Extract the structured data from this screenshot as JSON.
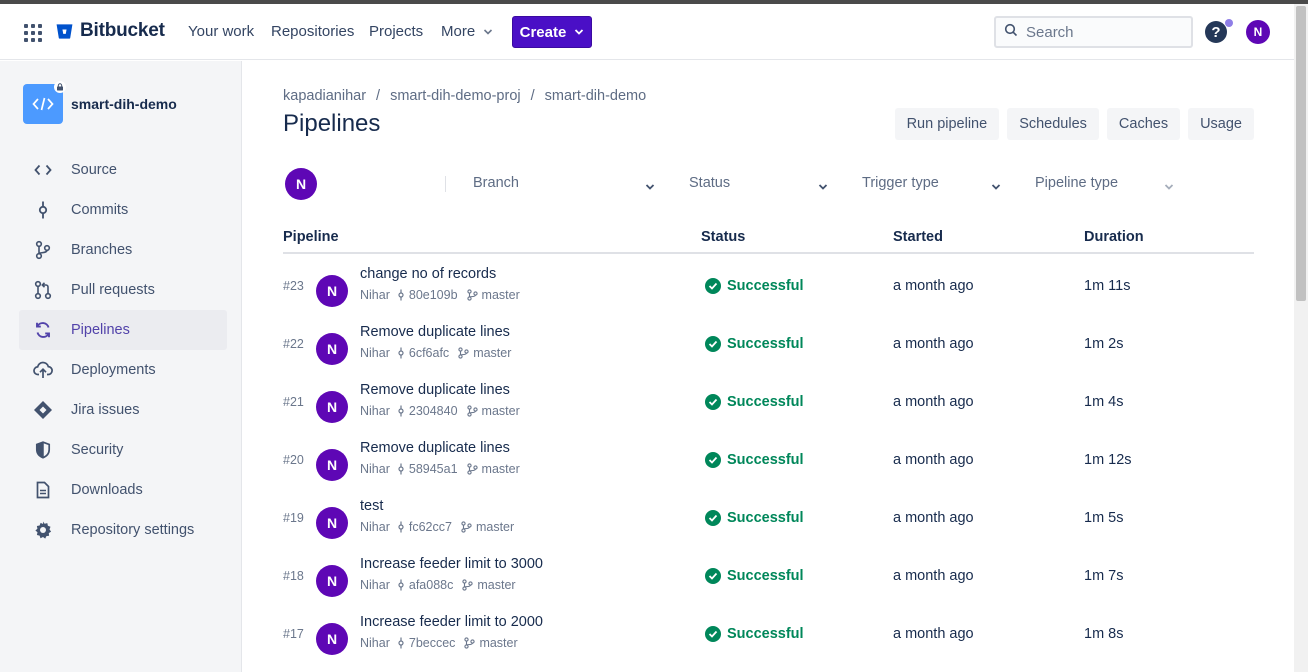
{
  "app": {
    "name": "Bitbucket"
  },
  "topnav": {
    "links": [
      "Your work",
      "Repositories",
      "Projects",
      "More"
    ],
    "create_label": "Create",
    "search_placeholder": "Search",
    "help_label": "?",
    "user_initial": "N"
  },
  "sidebar": {
    "repo_name": "smart-dih-demo",
    "items": [
      {
        "label": "Source",
        "icon": "code-icon"
      },
      {
        "label": "Commits",
        "icon": "commit-icon"
      },
      {
        "label": "Branches",
        "icon": "branch-icon"
      },
      {
        "label": "Pull requests",
        "icon": "pull-request-icon"
      },
      {
        "label": "Pipelines",
        "icon": "pipelines-icon",
        "active": true
      },
      {
        "label": "Deployments",
        "icon": "cloud-upload-icon"
      },
      {
        "label": "Jira issues",
        "icon": "jira-icon"
      },
      {
        "label": "Security",
        "icon": "shield-icon"
      },
      {
        "label": "Downloads",
        "icon": "document-icon"
      },
      {
        "label": "Repository settings",
        "icon": "gear-icon"
      }
    ]
  },
  "breadcrumb": [
    "kapadianihar",
    "smart-dih-demo-proj",
    "smart-dih-demo"
  ],
  "page": {
    "title": "Pipelines",
    "actions": [
      "Run pipeline",
      "Schedules",
      "Caches",
      "Usage"
    ]
  },
  "filters": {
    "avatar_initial": "N",
    "items": [
      "Branch",
      "Status",
      "Trigger type",
      "Pipeline type"
    ]
  },
  "table": {
    "headers": [
      "Pipeline",
      "Status",
      "Started",
      "Duration"
    ],
    "rows": [
      {
        "num": "#23",
        "initial": "N",
        "message": "change no of records",
        "author": "Nihar",
        "hash": "80e109b",
        "branch": "master",
        "status": "Successful",
        "started": "a month ago",
        "duration": "1m 11s"
      },
      {
        "num": "#22",
        "initial": "N",
        "message": "Remove duplicate lines",
        "author": "Nihar",
        "hash": "6cf6afc",
        "branch": "master",
        "status": "Successful",
        "started": "a month ago",
        "duration": "1m 2s"
      },
      {
        "num": "#21",
        "initial": "N",
        "message": "Remove duplicate lines",
        "author": "Nihar",
        "hash": "2304840",
        "branch": "master",
        "status": "Successful",
        "started": "a month ago",
        "duration": "1m 4s"
      },
      {
        "num": "#20",
        "initial": "N",
        "message": "Remove duplicate lines",
        "author": "Nihar",
        "hash": "58945a1",
        "branch": "master",
        "status": "Successful",
        "started": "a month ago",
        "duration": "1m 12s"
      },
      {
        "num": "#19",
        "initial": "N",
        "message": "test",
        "author": "Nihar",
        "hash": "fc62cc7",
        "branch": "master",
        "status": "Successful",
        "started": "a month ago",
        "duration": "1m 5s"
      },
      {
        "num": "#18",
        "initial": "N",
        "message": "Increase feeder limit to 3000",
        "author": "Nihar",
        "hash": "afa088c",
        "branch": "master",
        "status": "Successful",
        "started": "a month ago",
        "duration": "1m 7s"
      },
      {
        "num": "#17",
        "initial": "N",
        "message": "Increase feeder limit to 2000",
        "author": "Nihar",
        "hash": "7beccec",
        "branch": "master",
        "status": "Successful",
        "started": "a month ago",
        "duration": "1m 8s"
      }
    ]
  },
  "colors": {
    "brand": "#0052cc",
    "create_button": "#4a0fc6",
    "avatar": "#5e07b5",
    "success": "#00875a",
    "active_nav": "#5243aa"
  }
}
